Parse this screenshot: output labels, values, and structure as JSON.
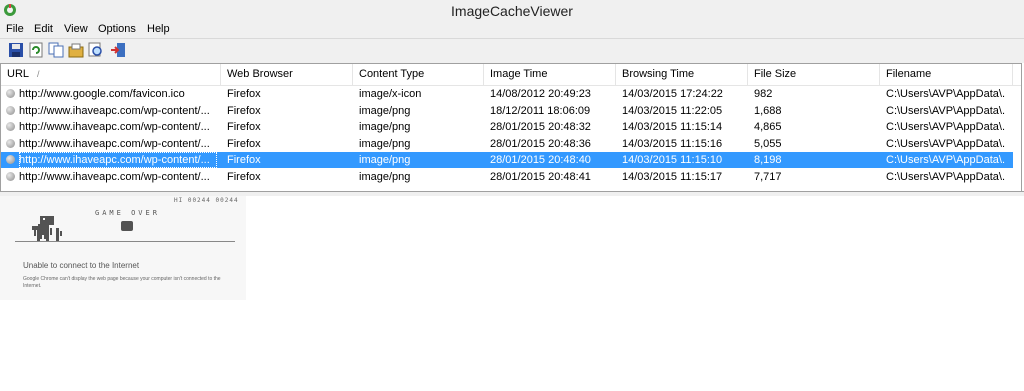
{
  "window": {
    "title": "ImageCacheViewer"
  },
  "menu": [
    "File",
    "Edit",
    "View",
    "Options",
    "Help"
  ],
  "toolbar": {
    "buttons": [
      "save-icon",
      "refresh-icon",
      "copy-icon",
      "properties-icon",
      "find-icon",
      "exit-icon"
    ]
  },
  "table": {
    "sorted_column": "URL",
    "columns": [
      "URL",
      "Web Browser",
      "Content Type",
      "Image Time",
      "Browsing Time",
      "File Size",
      "Filename"
    ],
    "rows": [
      [
        "http://www.google.com/favicon.ico",
        "Firefox",
        "image/x-icon",
        "14/08/2012 20:49:23",
        "14/03/2015 17:24:22",
        "982",
        "C:\\Users\\AVP\\AppData\\..."
      ],
      [
        "http://www.ihaveapc.com/wp-content/...",
        "Firefox",
        "image/png",
        "18/12/2011 18:06:09",
        "14/03/2015 11:22:05",
        "1,688",
        "C:\\Users\\AVP\\AppData\\..."
      ],
      [
        "http://www.ihaveapc.com/wp-content/...",
        "Firefox",
        "image/png",
        "28/01/2015 20:48:32",
        "14/03/2015 11:15:14",
        "4,865",
        "C:\\Users\\AVP\\AppData\\..."
      ],
      [
        "http://www.ihaveapc.com/wp-content/...",
        "Firefox",
        "image/png",
        "28/01/2015 20:48:36",
        "14/03/2015 11:15:16",
        "5,055",
        "C:\\Users\\AVP\\AppData\\..."
      ],
      [
        "http://www.ihaveapc.com/wp-content/...",
        "Firefox",
        "image/png",
        "28/01/2015 20:48:40",
        "14/03/2015 11:15:10",
        "8,198",
        "C:\\Users\\AVP\\AppData\\..."
      ],
      [
        "http://www.ihaveapc.com/wp-content/...",
        "Firefox",
        "image/png",
        "28/01/2015 20:48:41",
        "14/03/2015 11:15:17",
        "7,717",
        "C:\\Users\\AVP\\AppData\\..."
      ]
    ],
    "selected_row": 4
  },
  "preview": {
    "score": "HI 00244 00244",
    "game_over": "GAME OVER",
    "error_title": "Unable to connect to the Internet",
    "error_body": "Google Chrome can't display the web page because your computer isn't connected to the Internet."
  },
  "colors": {
    "selection": "#3399ff",
    "chrome_bg": "#f0f0f0"
  }
}
